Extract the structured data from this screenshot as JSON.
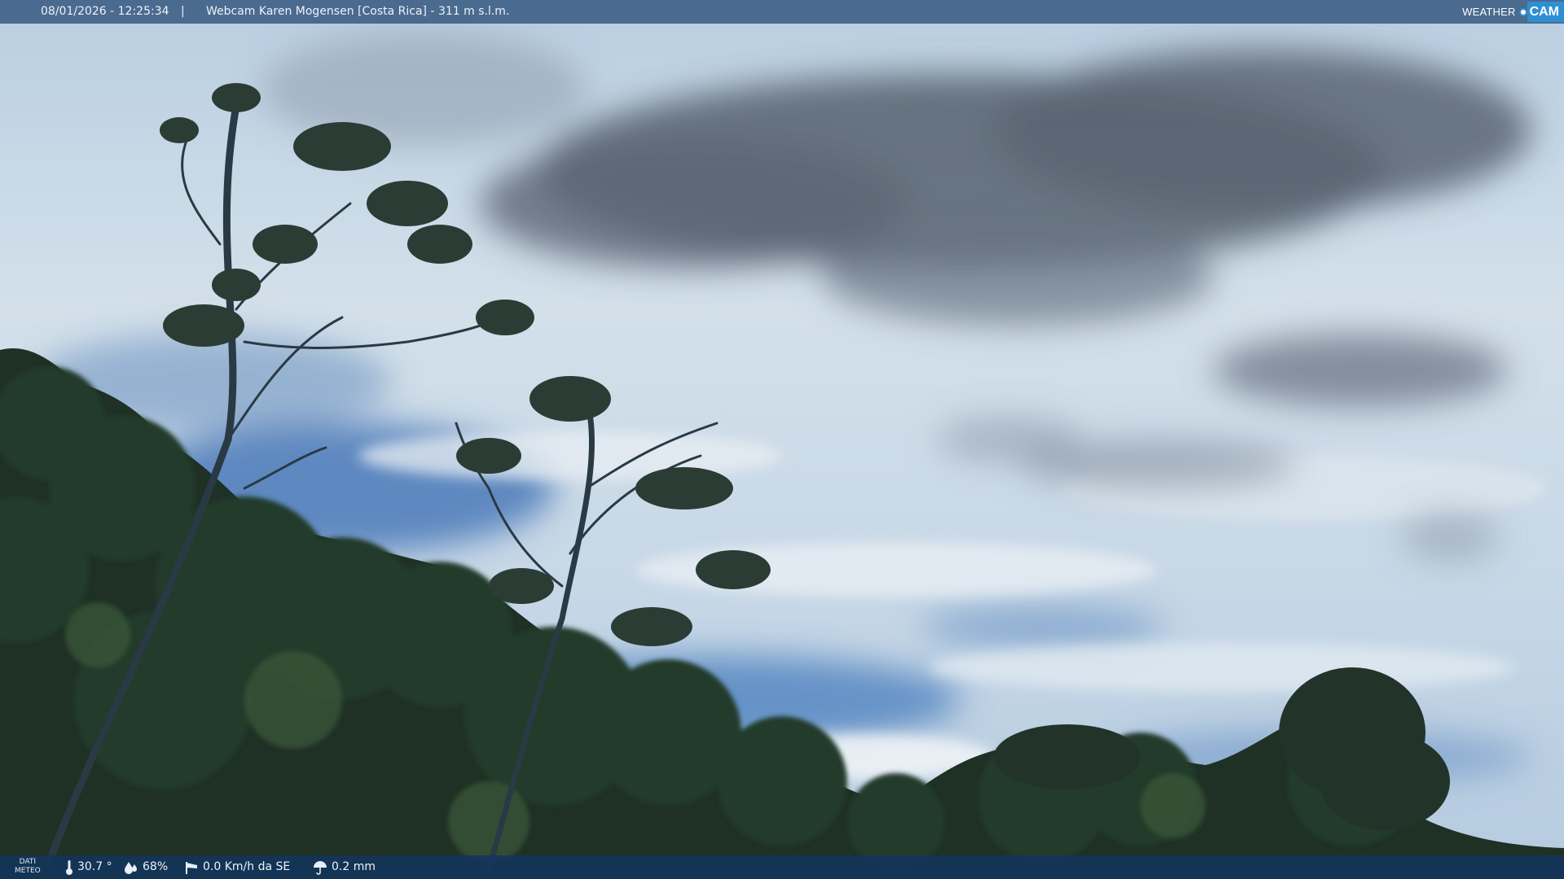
{
  "header": {
    "datetime": "08/01/2026 - 12:25:34",
    "separator": "|",
    "camera_label": "Webcam Karen Mogensen [Costa Rica]  - 311 m s.l.m.",
    "brand_weather": "WEATHER",
    "brand_cam": "CAM"
  },
  "footer": {
    "meteo_line1": "DATI",
    "meteo_line2": "METEO",
    "temperature": "30.7 °",
    "humidity": "68%",
    "wind": "0.0 Km/h da SE",
    "rain": "0.2 mm"
  },
  "colors": {
    "header_bar": "#32547d",
    "footer_bar": "#12345c",
    "sky_top": "#c9d9e6",
    "sky_blue": "#4f7fb8",
    "cloud_dark": "#4d5a6b",
    "foliage": "#1e2f23"
  },
  "icons": {
    "temperature": "thermometer-icon",
    "humidity": "humidity-drop-icon",
    "wind": "wind-sock-icon",
    "rain": "rain-umbrella-icon",
    "brand": "weathercam-logo"
  }
}
